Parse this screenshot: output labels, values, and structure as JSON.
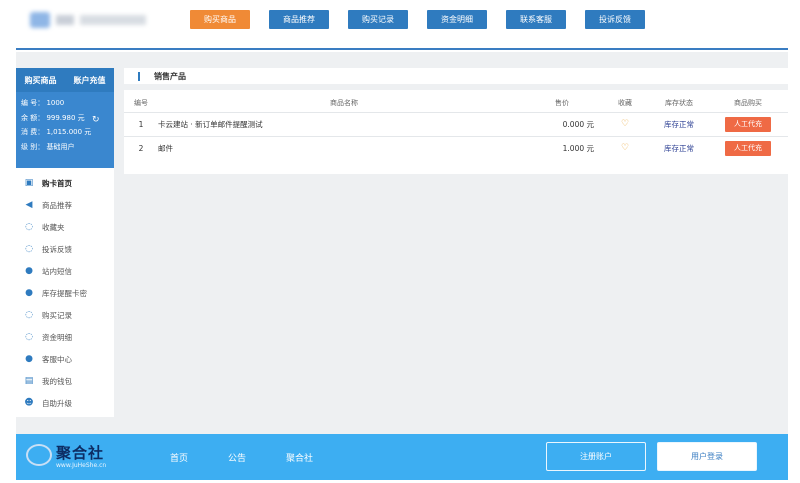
{
  "top_nav": [
    {
      "label": "购买商品",
      "active": true
    },
    {
      "label": "商品推荐",
      "active": false
    },
    {
      "label": "购买记录",
      "active": false
    },
    {
      "label": "资金明细",
      "active": false
    },
    {
      "label": "联系客服",
      "active": false
    },
    {
      "label": "投诉反馈",
      "active": false
    }
  ],
  "sidebar": {
    "tab_buy": "购买商品",
    "tab_recharge": "账户充值",
    "account": {
      "id_line": "编 号： 1000",
      "balance_line": "余 额： 999.980 元",
      "spent_line": "消 费： 1,015.000 元",
      "level_line": "级 别： 基础用户"
    },
    "menu": [
      {
        "label": "购卡首页",
        "icon": "shop-icon"
      },
      {
        "label": "商品推荐",
        "icon": "speaker-icon"
      },
      {
        "label": "收藏夹",
        "icon": "chat-icon"
      },
      {
        "label": "投诉反馈",
        "icon": "chat-icon"
      },
      {
        "label": "站内短信",
        "icon": "chat-bubbles-icon"
      },
      {
        "label": "库存提醒卡密",
        "icon": "chat-bubbles-icon"
      },
      {
        "label": "购买记录",
        "icon": "chat-icon"
      },
      {
        "label": "资金明细",
        "icon": "chat-icon"
      },
      {
        "label": "客服中心",
        "icon": "chat-bubbles-icon"
      },
      {
        "label": "我的钱包",
        "icon": "book-icon"
      },
      {
        "label": "自助升级",
        "icon": "user-icon"
      }
    ]
  },
  "main": {
    "title": "销售产品",
    "columns": [
      "编号",
      "商品名称",
      "售价",
      "收藏",
      "库存状态",
      "商品购买"
    ],
    "rows": [
      {
        "no": "1",
        "name": "卡云建站 · 新订单邮件提醒测试",
        "price": "0.000 元",
        "stock": "库存正常",
        "buy": "人工代充"
      },
      {
        "no": "2",
        "name": "邮件",
        "price": "1.000 元",
        "stock": "库存正常",
        "buy": "人工代充"
      }
    ]
  },
  "footer": {
    "logo_text": "聚合社",
    "logo_url": "www.JuHeShe.cn",
    "nav": [
      "首页",
      "公告",
      "聚合社"
    ],
    "register": "注册账户",
    "login": "用户登录"
  },
  "colors": {
    "accent": "#2f7bbf",
    "active_tab": "#f08a36",
    "buy_button": "#ef6a45",
    "footer": "#3daef2"
  }
}
